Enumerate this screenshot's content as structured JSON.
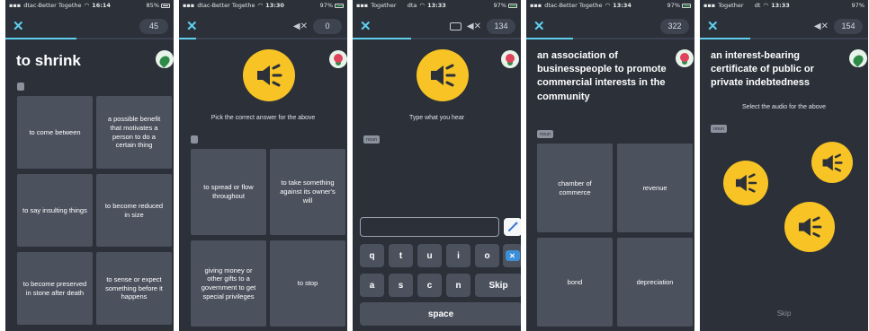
{
  "panels": [
    {
      "status_left": "dtac-Better Togethe",
      "status_time": "16:14",
      "status_battery": "85%",
      "score": "45",
      "word": "to shrink",
      "options": [
        "to come between",
        "a possible benefit that motivates a person to do a certain thing",
        "to say insulting things",
        "to become reduced in size",
        "to become preserved in stone after death",
        "to sense or expect something before it happens"
      ]
    },
    {
      "status_left": "dtac-Better Togethe",
      "status_time": "13:30",
      "status_battery": "97%",
      "score": "0",
      "instruction": "Pick the correct answer for the above",
      "options": [
        "to spread or flow throughout",
        "to take something against its owner's will",
        "giving money or other gifts to a government to get special privileges",
        "to stop"
      ]
    },
    {
      "status_left": "Together",
      "status_mid": "dta",
      "status_time": "13:33",
      "status_battery": "97%",
      "score": "134",
      "instruction": "Type what you hear",
      "tag": "noun",
      "keys_row1": [
        "q",
        "t",
        "u",
        "i",
        "o"
      ],
      "skip_label": "Skip",
      "space_label": "space"
    },
    {
      "status_left": "dtac-Better Togethe",
      "status_time": "13:34",
      "status_battery": "97%",
      "score": "322",
      "definition": "an association of businesspeople to promote commercial interests in the community",
      "tag": "noun",
      "options": [
        "chamber of commerce",
        "revenue",
        "bond",
        "depreciation"
      ]
    },
    {
      "status_left": "Together",
      "status_mid": "dt",
      "status_time": "13:33",
      "status_battery": "97%",
      "score": "154",
      "definition": "an interest-bearing certificate of public or private indebtedness",
      "instruction": "Select the audio for the above",
      "tag": "noun",
      "skip_label": "Skip"
    }
  ],
  "colors": {
    "background": "#2b3039",
    "card": "#4b525e",
    "accent": "#5fd0ee",
    "speaker": "#f7c325"
  }
}
